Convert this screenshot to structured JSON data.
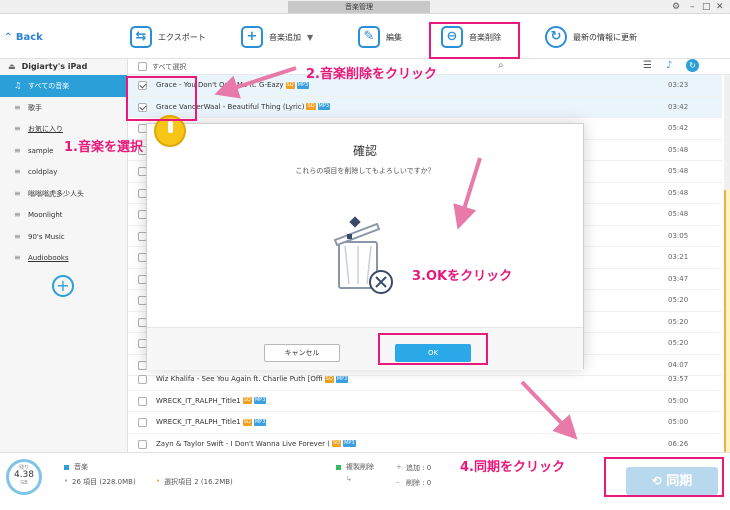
{
  "window": {
    "title": "音楽管理"
  },
  "toolbar": {
    "back": "Back",
    "export": "エクスポート",
    "add_music": "音楽追加",
    "edit": "編集",
    "delete_music": "音楽削除",
    "refresh": "最新の情報に更新"
  },
  "sidebar": {
    "device": "Digiarty's iPad",
    "items": [
      {
        "label": "すべての音楽"
      },
      {
        "label": "歌手"
      },
      {
        "label": "お気に入り"
      },
      {
        "label": "sample"
      },
      {
        "label": "coldplay"
      },
      {
        "label": "嗡嗡嗡虎多少人头"
      },
      {
        "label": "Moonlight"
      },
      {
        "label": "90's Music"
      },
      {
        "label": "Audiobooks"
      }
    ]
  },
  "list": {
    "select_all": "すべて選択",
    "rows": [
      {
        "title": "Grace - You Don't Own Me ft. G-Eazy",
        "duration": "03:23"
      },
      {
        "title": "Grace VanderWaal - Beautiful Thing (Lyric)",
        "duration": "03:42"
      },
      {
        "title": "",
        "duration": "05:42"
      },
      {
        "title": "",
        "duration": "05:48"
      },
      {
        "title": "",
        "duration": "05:48"
      },
      {
        "title": "",
        "duration": "05:48"
      },
      {
        "title": "",
        "duration": "05:48"
      },
      {
        "title": "",
        "duration": "03:05"
      },
      {
        "title": "",
        "duration": "03:21"
      },
      {
        "title": "",
        "duration": "03:47"
      },
      {
        "title": "",
        "duration": "05:20"
      },
      {
        "title": "",
        "duration": "05:20"
      },
      {
        "title": "",
        "duration": "05:20"
      },
      {
        "title": "",
        "duration": "04:07"
      },
      {
        "title": "Wiz Khalifa - See You Again ft. Charlie Puth [Offi",
        "duration": "03:57"
      },
      {
        "title": "WRECK_IT_RALPH_Title1",
        "duration": "05:00"
      },
      {
        "title": "WRECK_IT_RALPH_Title1",
        "duration": "05:00"
      },
      {
        "title": "Zayn & Taylor Swift - I Don't Wanna Live Forever (",
        "duration": "06:26"
      }
    ],
    "badge_sq": "SQ",
    "badge_mp3": "MP3",
    "partial_text": "1"
  },
  "dialog": {
    "title": "確認",
    "message": "これらの項目を削除してもよろしいですか？",
    "cancel": "キャンセル",
    "ok": "OK"
  },
  "bottom": {
    "capacity_label": "残り",
    "capacity_value": "4.38",
    "capacity_unit": "GB",
    "music_label": "音楽",
    "total_items": "26 項目 (228.0MB)",
    "selected_items": "選択項目 2 (16.2MB)",
    "mode": "複製削除",
    "added": "追加 : 0",
    "deleted": "削除 : 0",
    "sync": "同期"
  },
  "annotations": {
    "step1": "1.音楽を選択",
    "step2": "2.音楽削除をクリック",
    "step3": "3.OKをクリック",
    "step4": "4.同期をクリック",
    "color": "#e8197a"
  },
  "colors": {
    "accent": "#2a9fd8",
    "ok_button": "#2aa8e8"
  }
}
